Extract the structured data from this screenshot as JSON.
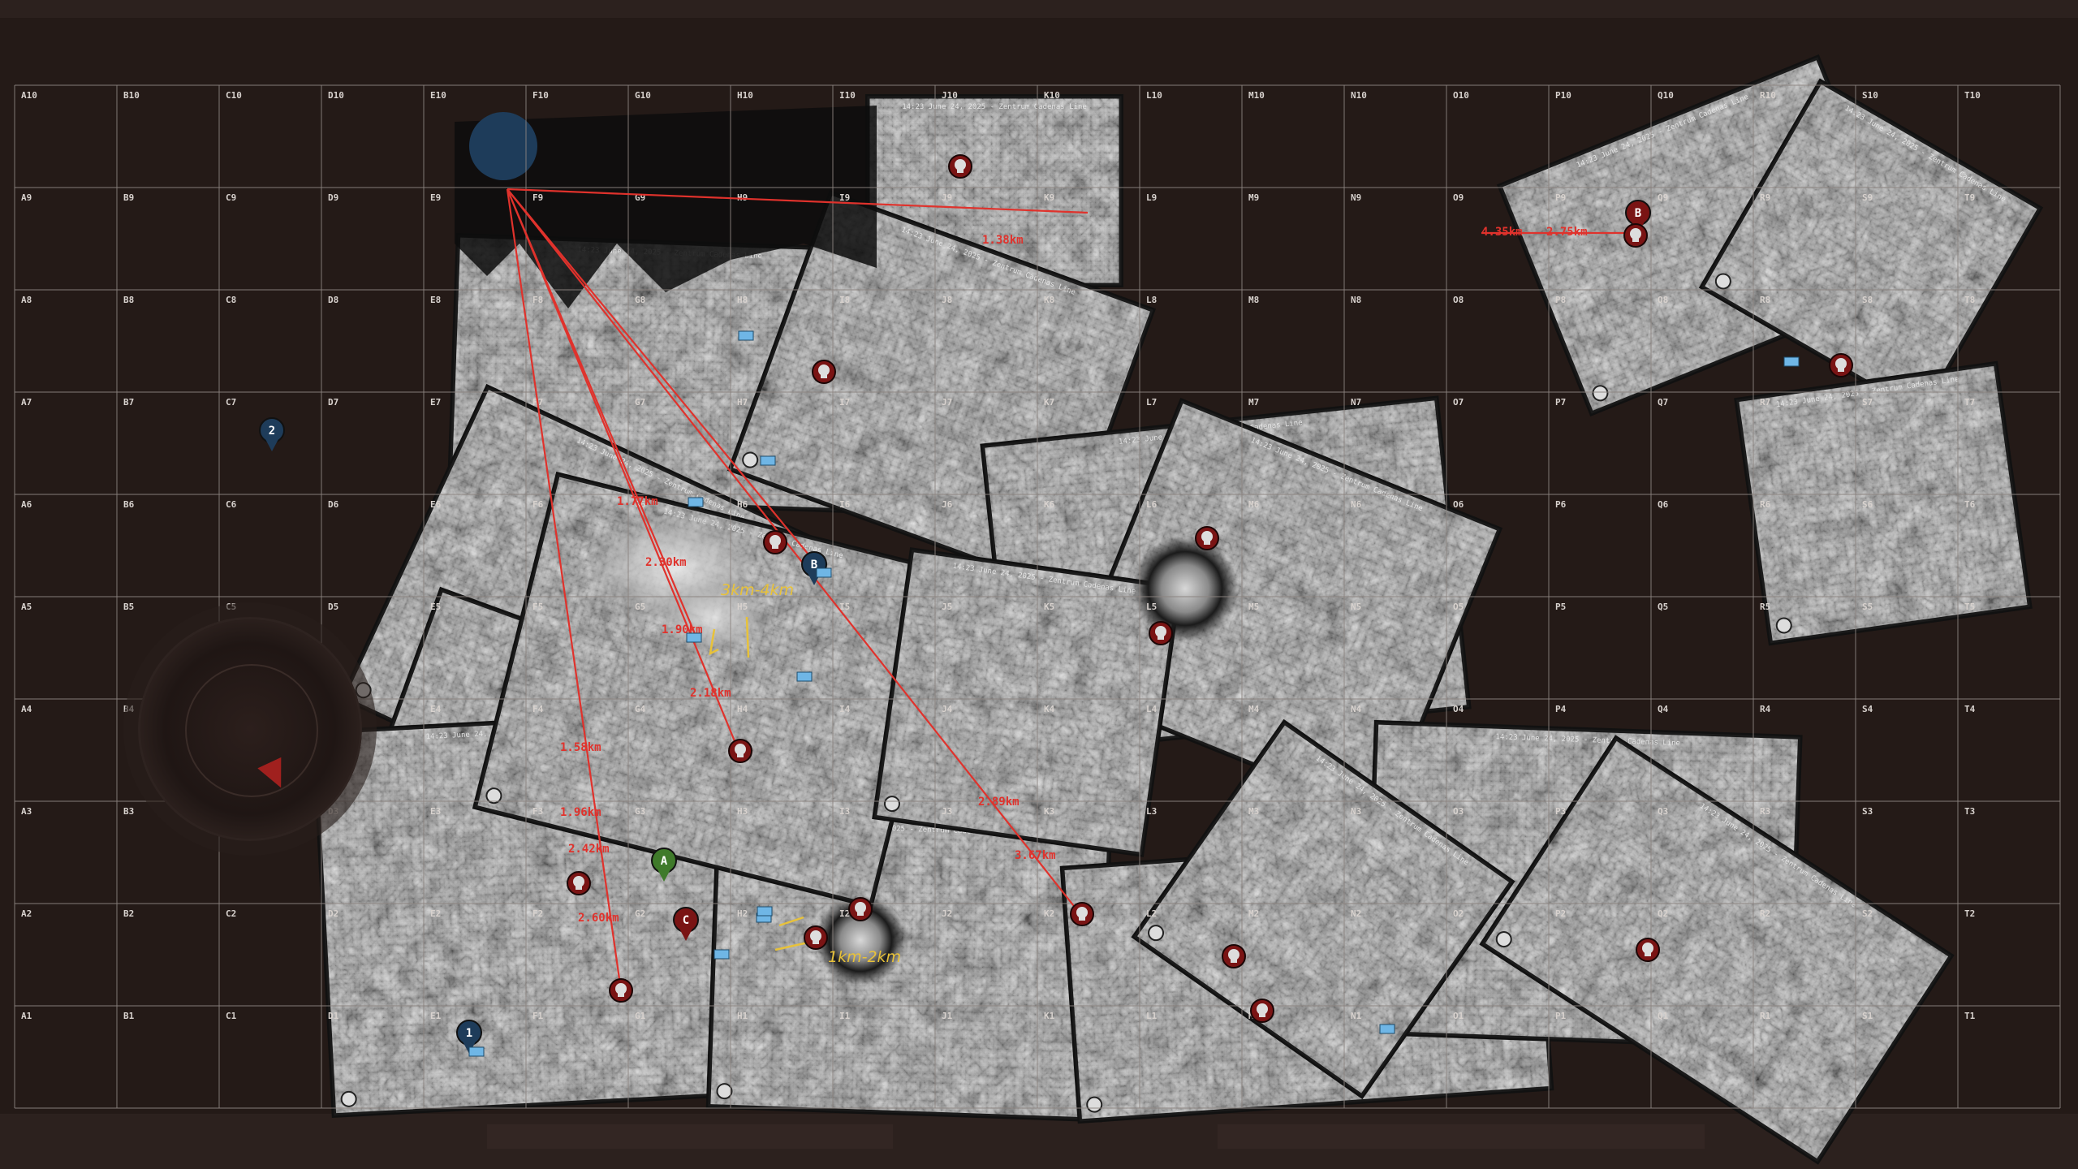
{
  "grid": {
    "columns": [
      "A",
      "B",
      "C",
      "D",
      "E",
      "F",
      "G",
      "H",
      "I",
      "J",
      "K",
      "L",
      "M",
      "N",
      "O",
      "P",
      "Q",
      "R",
      "S",
      "T"
    ],
    "rows": [
      10,
      9,
      8,
      7,
      6,
      5,
      4,
      3,
      2,
      1
    ]
  },
  "colors": {
    "background": "#241a17",
    "grid_line": "#8c8480",
    "grid_label": "#d8d2ce",
    "range_line": "#e0322c",
    "yellow_note": "#e8c23a",
    "marker_red": "#7a1414",
    "marker_blue": "#1e3c5a",
    "marker_green": "#3f7a2a",
    "marker_light_blue": "#6fb6e6"
  },
  "tiles": [
    {
      "rot": 0
    },
    {
      "rot": 2
    },
    {
      "rot": 20
    },
    {
      "rot": -6
    },
    {
      "rot": 22
    },
    {
      "rot": 25
    },
    {
      "rot": 20
    },
    {
      "rot": -3
    },
    {
      "rot": 2
    },
    {
      "rot": 14
    },
    {
      "rot": 8
    },
    {
      "rot": -4
    },
    {
      "rot": 2
    },
    {
      "rot": 33
    },
    {
      "rot": -22
    },
    {
      "rot": 30
    },
    {
      "rot": -8
    },
    {
      "rot": 35
    }
  ],
  "tile_caption": "14:23 June 24, 2025 - Zentrum Cadenas Line",
  "range_labels": [
    {
      "text": "1.38km"
    },
    {
      "text": "1.77km"
    },
    {
      "text": "2.30km"
    },
    {
      "text": "1.90km"
    },
    {
      "text": "2.18km"
    },
    {
      "text": "1.58km"
    },
    {
      "text": "1.96km"
    },
    {
      "text": "2.42km"
    },
    {
      "text": "2.60km"
    },
    {
      "text": "2.89km"
    },
    {
      "text": "3.67km"
    },
    {
      "text": "4.35km"
    },
    {
      "text": "2.75km"
    }
  ],
  "annotations": [
    {
      "text": "3km-4km"
    },
    {
      "text": "1km-2km"
    }
  ],
  "markers": {
    "squad_2": "2",
    "squad_1": "1",
    "squad_b": "B",
    "objective_a": "A",
    "objective_b": "B",
    "objective_c": "C"
  }
}
